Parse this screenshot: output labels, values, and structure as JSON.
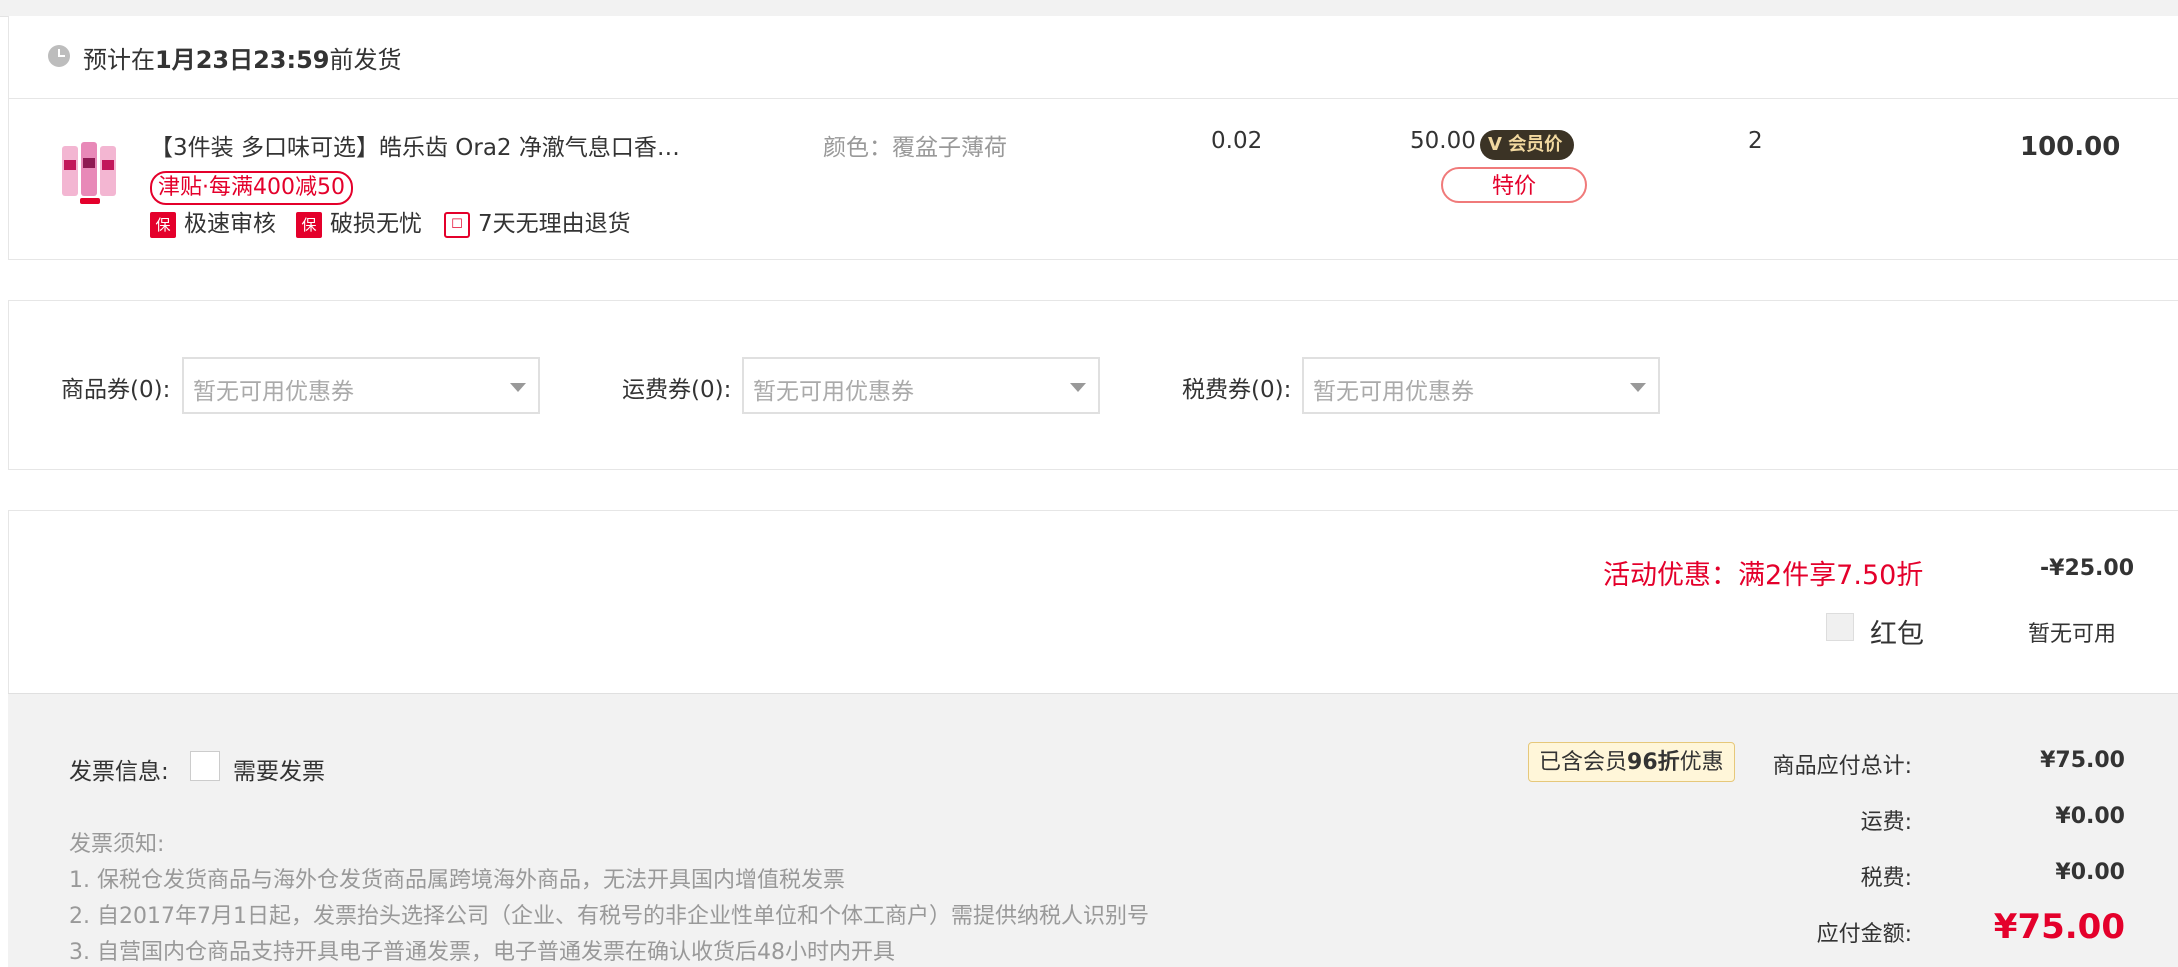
{
  "shipping": {
    "prefix": "预计在",
    "date": "1月23日23:59",
    "suffix": "前发货"
  },
  "item": {
    "title": "【3件装 多口味可选】皓乐齿 Ora2 净澈气息口香…",
    "promo": "津贴·每满400减50",
    "guarantees": [
      {
        "badge": "保",
        "label": "极速审核"
      },
      {
        "badge": "保",
        "label": "破损无忧"
      },
      {
        "badge": "☐",
        "label": "7天无理由退货"
      }
    ],
    "spec": "颜色：覆盆子薄荷",
    "tax": "0.02",
    "price": "50.00",
    "vip_badge": "V 会员价",
    "special_tag": "特价",
    "quantity": "2",
    "subtotal": "100.00"
  },
  "coupons": [
    {
      "label": "商品券(0):",
      "placeholder": "暂无可用优惠券"
    },
    {
      "label": "运费券(0):",
      "placeholder": "暂无可用优惠券"
    },
    {
      "label": "税费券(0):",
      "placeholder": "暂无可用优惠券"
    }
  ],
  "discounts": {
    "activity_label": "活动优惠：满2件享7.50折",
    "activity_value": "-¥25.00",
    "hongbao_label": "红包",
    "hongbao_value": "暂无可用"
  },
  "invoice": {
    "label": "发票信息:",
    "checkbox_label": "需要发票",
    "notice_title": "发票须知:",
    "notices": [
      "1. 保税仓发货商品与海外仓发货商品属跨境海外商品，无法开具国内增值税发票",
      "2. 自2017年7月1日起，发票抬头选择公司（企业、有税号的非企业性单位和个体工商户）需提供纳税人识别号",
      "3. 自营国内仓商品支持开具电子普通发票，电子普通发票在确认收货后48小时内开具"
    ]
  },
  "summary": {
    "member_tag_prefix": "已含会员",
    "member_tag_bold": "96折",
    "member_tag_suffix": "优惠",
    "goods_label": "商品应付总计:",
    "goods_value": "¥75.00",
    "shipping_label": "运费:",
    "shipping_value": "¥0.00",
    "tax_label": "税费:",
    "tax_value": "¥0.00",
    "pay_label": "应付金额:",
    "pay_value": "¥75.00"
  },
  "colors": {
    "accent_red": "#e4002b",
    "vip_dark": "#3b3325",
    "vip_gold": "#f2d9a0",
    "panel_gray": "#f2f2f2"
  }
}
